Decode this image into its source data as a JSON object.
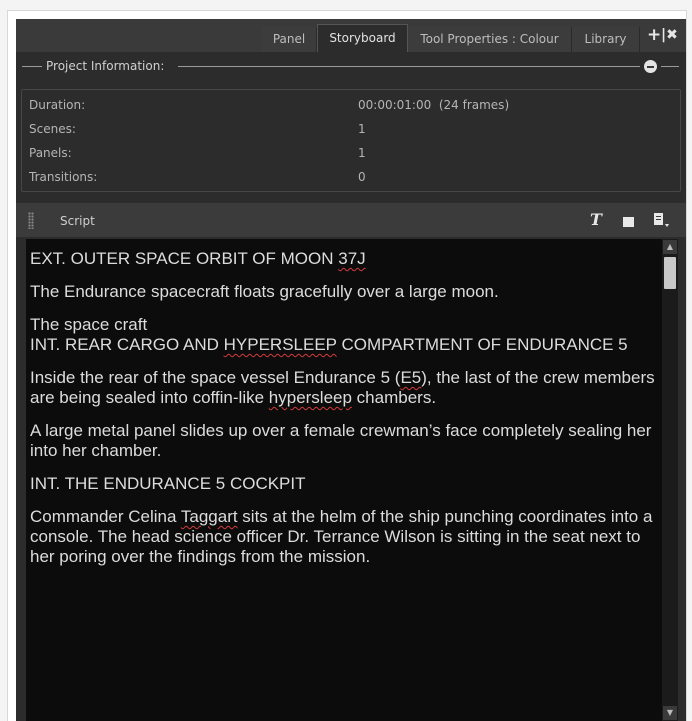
{
  "tabs": [
    {
      "label": "Panel",
      "active": false
    },
    {
      "label": "Storyboard",
      "active": true
    },
    {
      "label": "Tool Properties : Colour",
      "active": false
    },
    {
      "label": "Library",
      "active": false
    }
  ],
  "tab_controls": {
    "add_glyph": "+",
    "close_glyph": "|✖"
  },
  "project_info": {
    "legend": "Project Information:",
    "rows": [
      {
        "label": "Duration:",
        "value": "00:00:01:00  (24 frames)"
      },
      {
        "label": "Scenes:",
        "value": "1"
      },
      {
        "label": "Panels:",
        "value": "1"
      },
      {
        "label": "Transitions:",
        "value": "0"
      }
    ]
  },
  "script": {
    "label": "Script",
    "icons": [
      "text-format-icon",
      "window-icon",
      "document-menu-icon"
    ],
    "paragraphs": [
      [
        {
          "t": "EXT. OUTER SPACE ORBIT OF MOON "
        },
        {
          "t": "37J",
          "spell": true
        }
      ],
      [
        {
          "t": "The Endurance spacecraft floats gracefully over a large moon."
        }
      ],
      [
        {
          "t": "The space craft"
        },
        {
          "br": true
        },
        {
          "t": "INT. REAR CARGO AND "
        },
        {
          "t": "HYPERSLEEP",
          "spell": true
        },
        {
          "t": " COMPARTMENT OF ENDURANCE 5"
        }
      ],
      [
        {
          "t": "Inside the rear of the space vessel Endurance 5 ("
        },
        {
          "t": "E5",
          "spell": true
        },
        {
          "t": "), the last of the crew members are being sealed into coffin-like "
        },
        {
          "t": "hypersleep",
          "spell": true
        },
        {
          "t": " chambers."
        }
      ],
      [
        {
          "t": "A large metal panel slides up over a female crewman’s face completely sealing her into her chamber."
        }
      ],
      [
        {
          "t": "INT. THE ENDURANCE 5 COCKPIT"
        }
      ],
      [
        {
          "t": "Commander Celina "
        },
        {
          "t": "Taggart",
          "spell": true
        },
        {
          "t": " sits at the helm of the ship punching coordinates into a console. The head science officer Dr. Terrance Wilson is sitting in the seat next to her poring over the findings from the mission."
        }
      ]
    ]
  },
  "colors": {
    "panel_bg": "#2c2c2c",
    "script_bg": "#0c0c0c",
    "spellcheck": "#d23b3b"
  }
}
